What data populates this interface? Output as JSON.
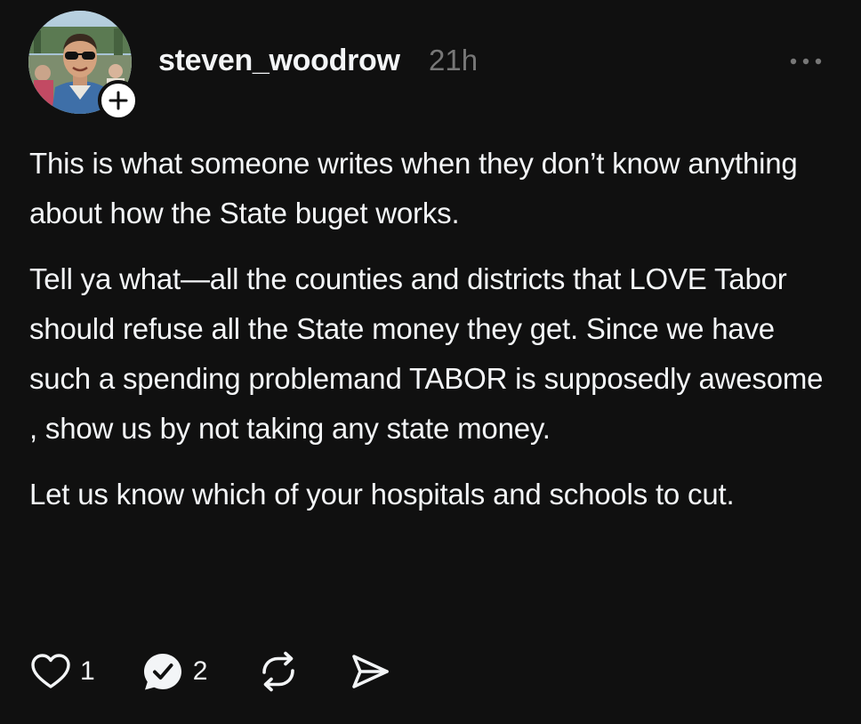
{
  "post": {
    "author": {
      "username": "steven_woodrow",
      "avatar_icon": "profile-photo",
      "follow_icon": "plus-icon"
    },
    "time_ago": "21h",
    "more_icon": "more-horizontal-icon",
    "paragraphs": [
      "This is what someone writes when they don’t know anything about how the State buget works.",
      "Tell ya what—all the counties and districts that LOVE Tabor should refuse all the State money they get. Since we have such a spending problemand TABOR is supposedly awesome , show us by not taking any state money.",
      "Let us know which of your hospitals and schools to cut."
    ],
    "actions": {
      "like_count": "1",
      "reply_count": "2",
      "like_icon": "heart-icon",
      "reply_icon": "reply-bubble-check-icon",
      "repost_icon": "repost-icon",
      "share_icon": "send-icon"
    }
  },
  "colors": {
    "background": "#101010",
    "text": "#f3f5f7",
    "muted": "#777777"
  }
}
